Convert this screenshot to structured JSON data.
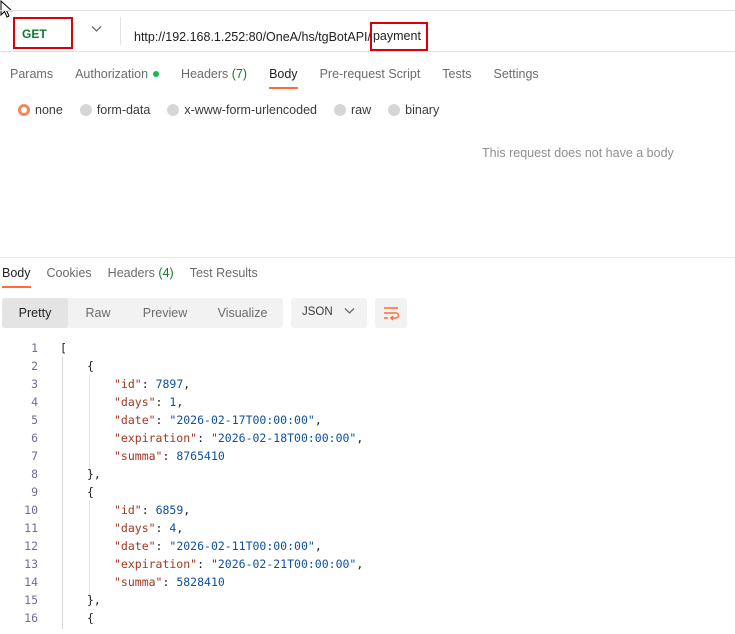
{
  "request": {
    "method": "GET",
    "url_base": "http://192.168.1.252:80/OneA/hs/tgBotAPI/",
    "url_highlight": "payment"
  },
  "request_tabs": {
    "params": "Params",
    "authorization": "Authorization",
    "headers": "Headers",
    "headers_count": "(7)",
    "body": "Body",
    "prerequest": "Pre-request Script",
    "tests": "Tests",
    "settings": "Settings"
  },
  "body_types": {
    "none": "none",
    "form_data": "form-data",
    "urlencoded": "x-www-form-urlencoded",
    "raw": "raw",
    "binary": "binary",
    "selected": "none"
  },
  "no_body_message": "This request does not have a body",
  "response_tabs": {
    "body": "Body",
    "cookies": "Cookies",
    "headers": "Headers",
    "headers_count": "(4)",
    "test_results": "Test Results"
  },
  "view_modes": {
    "pretty": "Pretty",
    "raw": "Raw",
    "preview": "Preview",
    "visualize": "Visualize",
    "active": "Pretty"
  },
  "format_select": "JSON",
  "code_lines": [
    {
      "n": "1",
      "indent": 0,
      "parts": [
        [
          "p",
          "["
        ]
      ]
    },
    {
      "n": "2",
      "indent": 1,
      "parts": [
        [
          "p",
          "{"
        ]
      ]
    },
    {
      "n": "3",
      "indent": 2,
      "parts": [
        [
          "k",
          "\"id\""
        ],
        [
          "p",
          ": "
        ],
        [
          "n",
          "7897"
        ],
        [
          "p",
          ","
        ]
      ]
    },
    {
      "n": "4",
      "indent": 2,
      "parts": [
        [
          "k",
          "\"days\""
        ],
        [
          "p",
          ": "
        ],
        [
          "n",
          "1"
        ],
        [
          "p",
          ","
        ]
      ]
    },
    {
      "n": "5",
      "indent": 2,
      "parts": [
        [
          "k",
          "\"date\""
        ],
        [
          "p",
          ": "
        ],
        [
          "s",
          "\"2026-02-17T00:00:00\""
        ],
        [
          "p",
          ","
        ]
      ]
    },
    {
      "n": "6",
      "indent": 2,
      "parts": [
        [
          "k",
          "\"expiration\""
        ],
        [
          "p",
          ": "
        ],
        [
          "s",
          "\"2026-02-18T00:00:00\""
        ],
        [
          "p",
          ","
        ]
      ]
    },
    {
      "n": "7",
      "indent": 2,
      "parts": [
        [
          "k",
          "\"summa\""
        ],
        [
          "p",
          ": "
        ],
        [
          "n",
          "8765410"
        ]
      ]
    },
    {
      "n": "8",
      "indent": 1,
      "parts": [
        [
          "p",
          "},"
        ]
      ]
    },
    {
      "n": "9",
      "indent": 1,
      "parts": [
        [
          "p",
          "{"
        ]
      ]
    },
    {
      "n": "10",
      "indent": 2,
      "parts": [
        [
          "k",
          "\"id\""
        ],
        [
          "p",
          ": "
        ],
        [
          "n",
          "6859"
        ],
        [
          "p",
          ","
        ]
      ]
    },
    {
      "n": "11",
      "indent": 2,
      "parts": [
        [
          "k",
          "\"days\""
        ],
        [
          "p",
          ": "
        ],
        [
          "n",
          "4"
        ],
        [
          "p",
          ","
        ]
      ]
    },
    {
      "n": "12",
      "indent": 2,
      "parts": [
        [
          "k",
          "\"date\""
        ],
        [
          "p",
          ": "
        ],
        [
          "s",
          "\"2026-02-11T00:00:00\""
        ],
        [
          "p",
          ","
        ]
      ]
    },
    {
      "n": "13",
      "indent": 2,
      "parts": [
        [
          "k",
          "\"expiration\""
        ],
        [
          "p",
          ": "
        ],
        [
          "s",
          "\"2026-02-21T00:00:00\""
        ],
        [
          "p",
          ","
        ]
      ]
    },
    {
      "n": "14",
      "indent": 2,
      "parts": [
        [
          "k",
          "\"summa\""
        ],
        [
          "p",
          ": "
        ],
        [
          "n",
          "5828410"
        ]
      ]
    },
    {
      "n": "15",
      "indent": 1,
      "parts": [
        [
          "p",
          "},"
        ]
      ]
    },
    {
      "n": "16",
      "indent": 1,
      "parts": [
        [
          "p",
          "{"
        ]
      ]
    }
  ],
  "colors": {
    "accent": "#ff6c37",
    "highlight_box": "#d9000d",
    "method_green": "#0f7a2e"
  },
  "icons": {
    "cursor": "mouse-pointer-icon",
    "method_dropdown": "chevron-down-icon",
    "auth_status": "green-dot-icon",
    "format_dropdown": "chevron-down-icon",
    "wrap": "wrap-lines-icon"
  }
}
